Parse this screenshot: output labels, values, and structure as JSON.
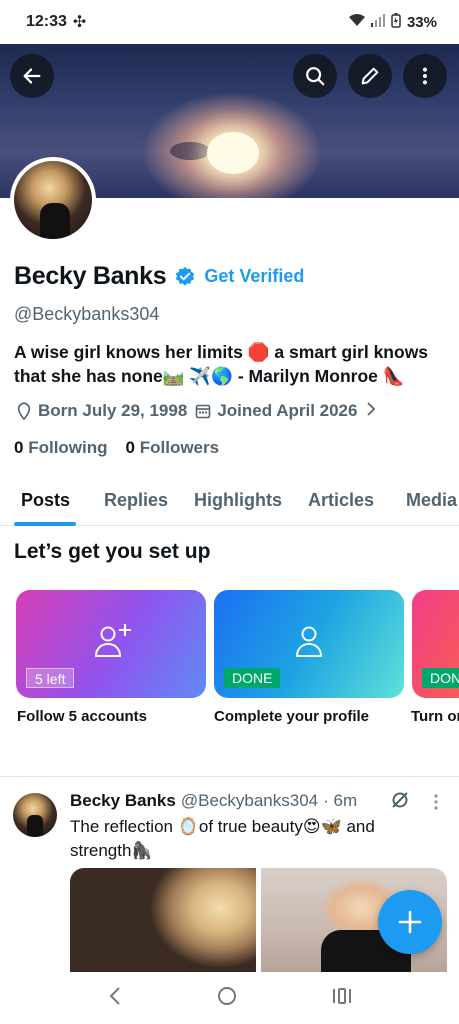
{
  "status_bar": {
    "time": "12:33",
    "battery": "33%"
  },
  "profile": {
    "display_name": "Becky Banks",
    "get_verified": "Get Verified",
    "handle": "@Beckybanks304",
    "bio_line1": "A wise girl knows her limits 🛑 a smart girl knows",
    "bio_line2": "that she has none🛤️ ✈️🌎        - Marilyn Monroe 👠",
    "born": "Born July 29, 1998",
    "joined": "Joined April 2026",
    "following_count": "0",
    "following_label": "Following",
    "followers_count": "0",
    "followers_label": "Followers"
  },
  "tabs": [
    {
      "label": "Posts"
    },
    {
      "label": "Replies"
    },
    {
      "label": "Highlights"
    },
    {
      "label": "Articles"
    },
    {
      "label": "Media"
    }
  ],
  "setup": {
    "title": "Let’s get you set up",
    "cards": [
      {
        "badge": "5 left",
        "label": "Follow 5 accounts"
      },
      {
        "badge": "DONE",
        "label": "Complete your profile"
      },
      {
        "badge": "DONE",
        "label": "Turn on"
      }
    ]
  },
  "post": {
    "name": "Becky Banks",
    "handle": "@Beckybanks304",
    "time": "· 6m",
    "text_line1": "The reflection 🪞of true beauty😍🦋 and",
    "text_line2": "strength🦍"
  },
  "colors": {
    "accent": "#1d9bf0",
    "done_green": "#00a96b",
    "secondary_text": "#536471"
  }
}
